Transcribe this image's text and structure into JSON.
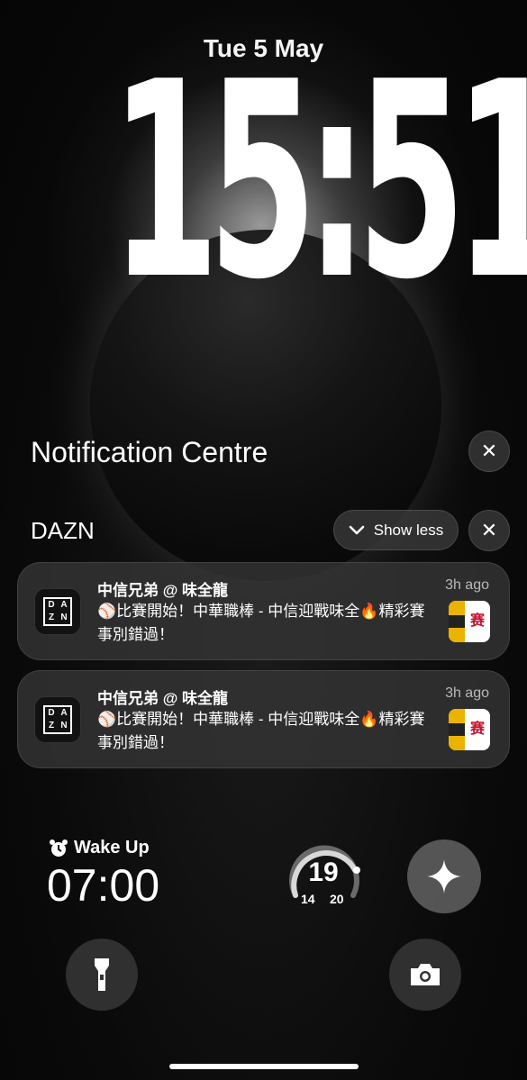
{
  "lockscreen": {
    "date": "Tue 5 May",
    "time": "15:51"
  },
  "notification_centre": {
    "title": "Notification Centre",
    "close_label": "✕"
  },
  "group": {
    "app_name": "DAZN",
    "show_less_label": "Show less",
    "close_label": "✕",
    "notifications": [
      {
        "title": "中信兄弟 @ 味全龍",
        "time": "3h ago",
        "body": "⚾比賽開始！中華職棒 - 中信迎戰味全🔥精彩賽事別錯過！"
      },
      {
        "title": "中信兄弟 @ 味全龍",
        "time": "3h ago",
        "body": "⚾比賽開始！中華職棒 - 中信迎戰味全🔥精彩賽事別錯過！"
      }
    ],
    "app_icon_letters": [
      "D",
      "A",
      "Z",
      "N"
    ]
  },
  "widgets": {
    "alarm_label": "Wake Up",
    "alarm_time": "07:00",
    "weather_temp": "19",
    "weather_low": "14",
    "weather_high": "20"
  },
  "icons": {
    "alarm": "alarm-clock-icon",
    "assistant": "sparkle-icon",
    "flashlight": "flashlight-icon",
    "camera": "camera-icon"
  }
}
